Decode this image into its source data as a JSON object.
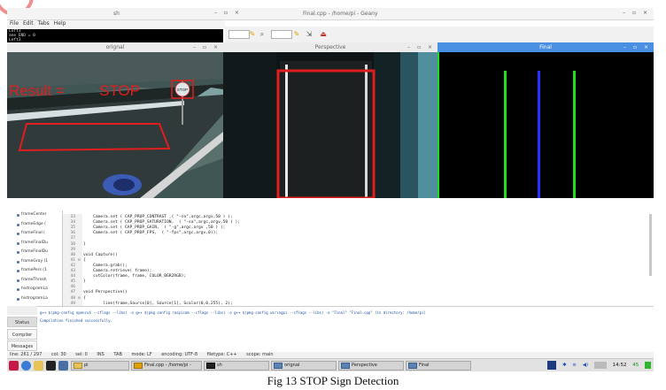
{
  "terminal_window": {
    "title": "sh",
    "controls": "– ▫ ×",
    "menu": [
      "File",
      "Edit",
      "Tabs",
      "Help"
    ],
    "lines": [
      "Left3",
      "ane END = 0",
      "Left3"
    ]
  },
  "geany_window": {
    "title": "Final.cpp - /home/pi - Geany",
    "controls": "– ▫ ×"
  },
  "image_windows": {
    "orig": {
      "title": "orignal",
      "controls": "– ▫ ×",
      "overlay_result": "Result  =",
      "overlay_stop": "STOP",
      "sign_text": "STOP"
    },
    "persp": {
      "title": "Perspective",
      "controls": "– ▫ ×"
    },
    "final": {
      "title": "Final",
      "controls": "– ▫ ×"
    }
  },
  "symbols": [
    "frameCenter",
    "frameEdge (",
    "frameFinal (",
    "frameFinalDu",
    "frameFinalDu",
    "frameGray (1",
    "framePers (1",
    "frameThresh",
    "histrogramLa",
    "histrogramLa",
    "laneCenter ("
  ],
  "code_lines": [
    {
      "ln": "33",
      "fold": "",
      "text": "    Camera.set ( CAP_PROP_CONTRAST ,( \"-co\",argc,argv,50 ) );"
    },
    {
      "ln": "34",
      "fold": "",
      "text": "    Camera.set ( CAP_PROP_SATURATION,  ( \"-sa\",argc,argv,50 ) );"
    },
    {
      "ln": "35",
      "fold": "",
      "text": "    Camera.set ( CAP_PROP_GAIN,  ( \"-g\",argc,argv ,50 ) );"
    },
    {
      "ln": "36",
      "fold": "",
      "text": "    Camera.set ( CAP_PROP_FPS,  ( \"-fps\",argc,argv,0));"
    },
    {
      "ln": "37",
      "fold": "",
      "text": ""
    },
    {
      "ln": "38",
      "fold": "",
      "text": "}"
    },
    {
      "ln": "39",
      "fold": "",
      "text": ""
    },
    {
      "ln": "40",
      "fold": "",
      "text": "void Capture()"
    },
    {
      "ln": "41",
      "fold": "⊟",
      "text": "{"
    },
    {
      "ln": "42",
      "fold": "",
      "text": "    Camera.grab();"
    },
    {
      "ln": "43",
      "fold": "",
      "text": "    Camera.retrieve( frame);"
    },
    {
      "ln": "44",
      "fold": "",
      "text": "    cvtColor(frame, frame, COLOR_BGR2RGB);"
    },
    {
      "ln": "45",
      "fold": "",
      "text": "}"
    },
    {
      "ln": "46",
      "fold": "",
      "text": ""
    },
    {
      "ln": "47",
      "fold": "",
      "text": "void Perspective()"
    },
    {
      "ln": "48",
      "fold": "⊟",
      "text": "{"
    },
    {
      "ln": "49",
      "fold": "",
      "text": "        line(frame,Source[0], Source[1], Scalar(0,0,255), 2);"
    }
  ],
  "panel_tabs": [
    "Status",
    "Compiler",
    "Messages"
  ],
  "messages": [
    "g++ $(pkg-config opencv4 --cflags --libs) -o g++ $(pkg-config raspicam --cflags --libs) -o g++ $(pkg-config wiringpi --cflags --libs) -o \"Final\" \"Final.cpp\" (in directory: /home/pi)",
    "Compilation finished successfully."
  ],
  "statusbar": [
    "line: 261 / 297",
    "col: 30",
    "sel: 0",
    "INS",
    "TAB",
    "mode: LF",
    "encoding: UTF-8",
    "filetype: C++",
    "scope: main"
  ],
  "taskbar": {
    "tasks": [
      "pi",
      "Final.cpp - /home/pi -",
      "sh",
      "orignal",
      "Perspective",
      "Final"
    ],
    "clock": "14:52",
    "battery": "45"
  },
  "caption": "Fig 13 STOP Sign Detection",
  "colors": {
    "accent": "#4a90e2",
    "overlay_red": "#e01e1e",
    "lane_green": "#22dd22",
    "lane_blue": "#2233ff"
  }
}
